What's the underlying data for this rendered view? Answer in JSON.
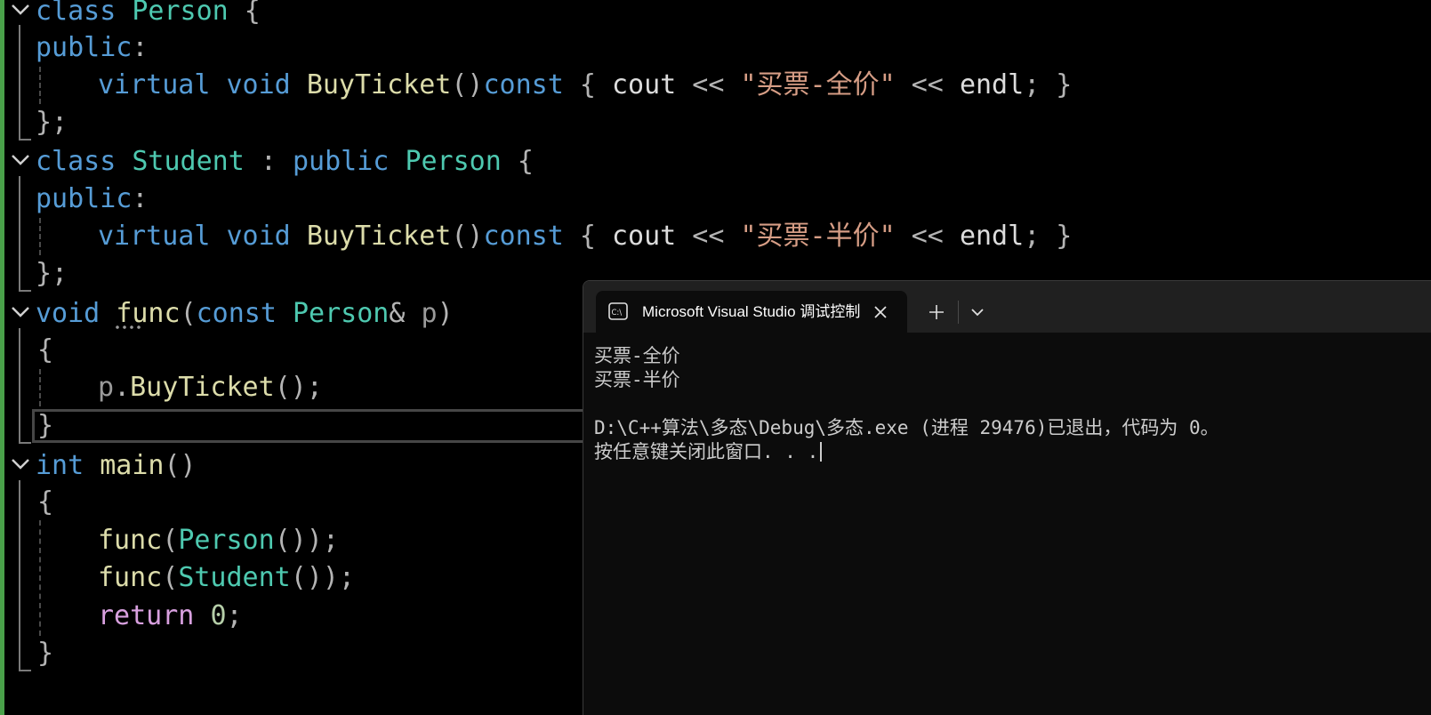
{
  "editor": {
    "lines": [
      {
        "tokens": [
          {
            "t": "class",
            "c": "kw"
          },
          {
            "t": " ",
            "c": "plain"
          },
          {
            "t": "Person",
            "c": "ty"
          },
          {
            "t": " {",
            "c": "pun"
          }
        ]
      },
      {
        "tokens": [
          {
            "t": "public",
            "c": "kw"
          },
          {
            "t": ":",
            "c": "pun"
          }
        ]
      },
      {
        "tokens": [
          {
            "t": "virtual",
            "c": "kw"
          },
          {
            "t": " ",
            "c": "plain"
          },
          {
            "t": "void",
            "c": "kw"
          },
          {
            "t": " ",
            "c": "plain"
          },
          {
            "t": "BuyTicket",
            "c": "fn"
          },
          {
            "t": "()",
            "c": "pun"
          },
          {
            "t": "const",
            "c": "kw"
          },
          {
            "t": " { ",
            "c": "pun"
          },
          {
            "t": "cout",
            "c": "plain"
          },
          {
            "t": " << ",
            "c": "pun"
          },
          {
            "t": "\"买票-全价\"",
            "c": "str"
          },
          {
            "t": " << ",
            "c": "pun"
          },
          {
            "t": "endl",
            "c": "plain"
          },
          {
            "t": "; }",
            "c": "pun"
          }
        ]
      },
      {
        "tokens": [
          {
            "t": "};",
            "c": "pun"
          }
        ]
      },
      {
        "tokens": [
          {
            "t": "class",
            "c": "kw"
          },
          {
            "t": " ",
            "c": "plain"
          },
          {
            "t": "Student",
            "c": "ty"
          },
          {
            "t": " : ",
            "c": "pun"
          },
          {
            "t": "public",
            "c": "kw"
          },
          {
            "t": " ",
            "c": "plain"
          },
          {
            "t": "Person",
            "c": "ty"
          },
          {
            "t": " {",
            "c": "pun"
          }
        ]
      },
      {
        "tokens": [
          {
            "t": "public",
            "c": "kw"
          },
          {
            "t": ":",
            "c": "pun"
          }
        ]
      },
      {
        "tokens": [
          {
            "t": "virtual",
            "c": "kw"
          },
          {
            "t": " ",
            "c": "plain"
          },
          {
            "t": "void",
            "c": "kw"
          },
          {
            "t": " ",
            "c": "plain"
          },
          {
            "t": "BuyTicket",
            "c": "fn"
          },
          {
            "t": "()",
            "c": "pun"
          },
          {
            "t": "const",
            "c": "kw"
          },
          {
            "t": " { ",
            "c": "pun"
          },
          {
            "t": "cout",
            "c": "plain"
          },
          {
            "t": " << ",
            "c": "pun"
          },
          {
            "t": "\"买票-半价\"",
            "c": "str"
          },
          {
            "t": " << ",
            "c": "pun"
          },
          {
            "t": "endl",
            "c": "plain"
          },
          {
            "t": "; }",
            "c": "pun"
          }
        ]
      },
      {
        "tokens": [
          {
            "t": "};",
            "c": "pun"
          }
        ]
      },
      {
        "tokens": [
          {
            "t": "void",
            "c": "kw"
          },
          {
            "t": " ",
            "c": "plain"
          },
          {
            "t": "func",
            "c": "fn"
          },
          {
            "t": "(",
            "c": "pun"
          },
          {
            "t": "const",
            "c": "kw"
          },
          {
            "t": " ",
            "c": "plain"
          },
          {
            "t": "Person",
            "c": "ty"
          },
          {
            "t": "& ",
            "c": "pun"
          },
          {
            "t": "p",
            "c": "prm"
          },
          {
            "t": ")",
            "c": "pun"
          }
        ]
      },
      {
        "tokens": [
          {
            "t": "{",
            "c": "pun"
          }
        ]
      },
      {
        "tokens": [
          {
            "t": "p",
            "c": "prm"
          },
          {
            "t": ".",
            "c": "pun"
          },
          {
            "t": "BuyTicket",
            "c": "fn"
          },
          {
            "t": "();",
            "c": "pun"
          }
        ]
      },
      {
        "tokens": [
          {
            "t": "}",
            "c": "pun"
          }
        ]
      },
      {
        "tokens": [
          {
            "t": "int",
            "c": "kw"
          },
          {
            "t": " ",
            "c": "plain"
          },
          {
            "t": "main",
            "c": "fn"
          },
          {
            "t": "()",
            "c": "pun"
          }
        ]
      },
      {
        "tokens": [
          {
            "t": "{",
            "c": "pun"
          }
        ]
      },
      {
        "tokens": [
          {
            "t": "func",
            "c": "fn"
          },
          {
            "t": "(",
            "c": "pun"
          },
          {
            "t": "Person",
            "c": "ty"
          },
          {
            "t": "());",
            "c": "pun"
          }
        ]
      },
      {
        "tokens": [
          {
            "t": "func",
            "c": "fn"
          },
          {
            "t": "(",
            "c": "pun"
          },
          {
            "t": "Student",
            "c": "ty"
          },
          {
            "t": "());",
            "c": "pun"
          }
        ]
      },
      {
        "tokens": [
          {
            "t": "return",
            "c": "ctl"
          },
          {
            "t": " ",
            "c": "plain"
          },
          {
            "t": "0",
            "c": "num"
          },
          {
            "t": ";",
            "c": "pun"
          }
        ]
      },
      {
        "tokens": [
          {
            "t": "}",
            "c": "pun"
          }
        ]
      }
    ]
  },
  "terminal": {
    "tab_title": "Microsoft Visual Studio 调试控制台",
    "tab_icon": "console-icon",
    "output": [
      "买票-全价",
      "买票-半价",
      "",
      "D:\\C++算法\\多态\\Debug\\多态.exe (进程 29476)已退出，代码为 0。",
      "按任意键关闭此窗口. . ."
    ]
  },
  "colors": {
    "keyword": "#569cd6",
    "type": "#4ec9b0",
    "function": "#dcdcaa",
    "string": "#d69d85",
    "control": "#d8a0df",
    "number": "#b5cea8",
    "change_bar": "#4aa14a",
    "terminal_bg": "#0c0c0c",
    "titlebar_bg": "#202020"
  }
}
